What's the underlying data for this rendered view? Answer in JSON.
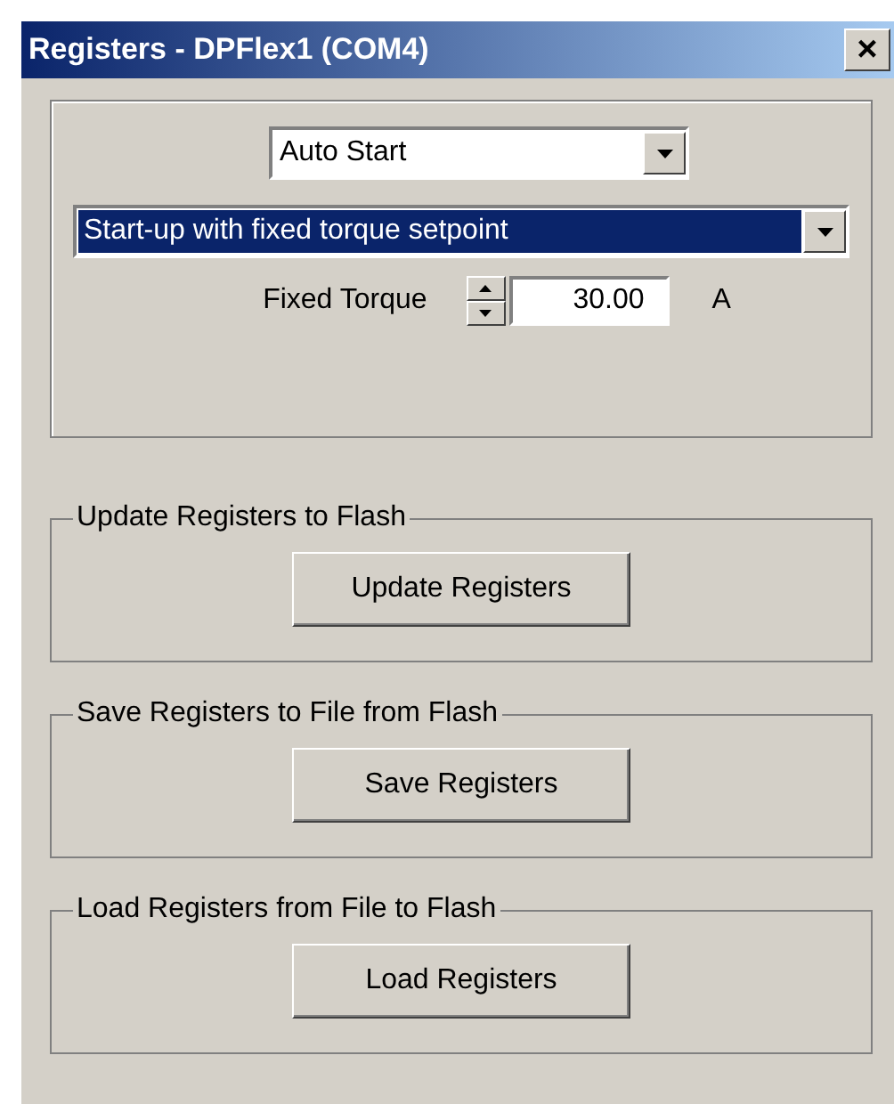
{
  "window": {
    "title": "Registers - DPFlex1 (COM4)",
    "close": "×"
  },
  "mode_select": {
    "value": "Auto Start"
  },
  "startup_select": {
    "value": "Start-up with fixed torque setpoint",
    "highlighted": true
  },
  "fixed_torque": {
    "label": "Fixed Torque",
    "value": "30.00",
    "unit": "A"
  },
  "groups": [
    {
      "title": "Update Registers to Flash",
      "button": "Update Registers"
    },
    {
      "title": "Save Registers to File from Flash",
      "button": "Save Registers"
    },
    {
      "title": "Load Registers from File to Flash",
      "button": "Load Registers"
    }
  ]
}
